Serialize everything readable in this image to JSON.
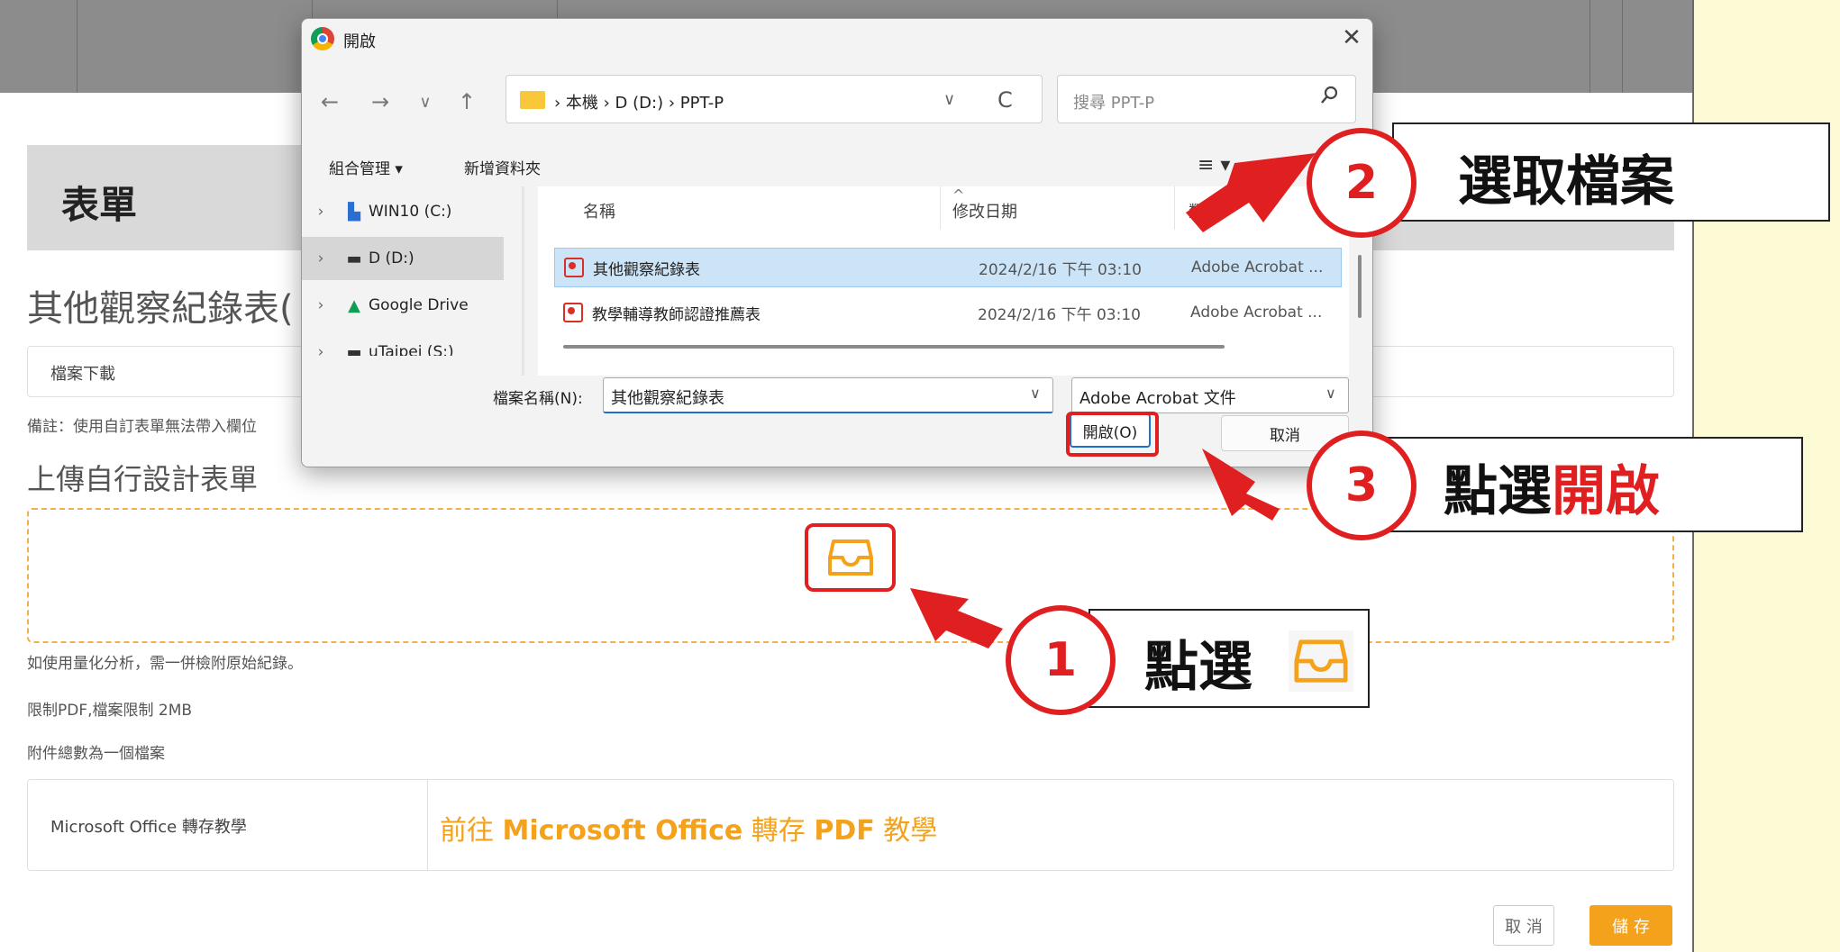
{
  "webpage": {
    "form_title": "表單",
    "section_title": "其他觀察紀錄表(",
    "download_label": "檔案下載",
    "note": "備註：使用自訂表單無法帶入欄位",
    "upload_title": "上傳自行設計表單",
    "hints": [
      "如使用量化分析，需一併檢附原始紀錄。",
      "限制PDF,檔案限制 2MB",
      "附件總數為一個檔案"
    ],
    "ms_label": "Microsoft Office 轉存教學",
    "ms_link_prefix": "前往 ",
    "ms_link_brand": "Microsoft Office",
    "ms_link_mid": " 轉存 ",
    "ms_link_pdf": "PDF",
    "ms_link_suffix": " 教學",
    "cancel_label": "取 消",
    "save_label": "儲 存",
    "accent_color": "#f4a21b"
  },
  "dialog": {
    "title": "開啟",
    "close": "✕",
    "nav": {
      "back": "←",
      "forward": "→",
      "recent": "∨",
      "up": "↑"
    },
    "breadcrumb": "›  本機  ›  D (D:)  ›  PPT-P",
    "addr_dropdown": "∨",
    "refresh": "C",
    "search_placeholder": "搜尋 PPT-P",
    "organize_label": "組合管理 ▾",
    "new_folder_label": "新增資料夾",
    "view_label": "≡ ▾",
    "nav_items": [
      {
        "icon": "drive-c-icon",
        "glyph": "▙",
        "label": "WIN10 (C:)"
      },
      {
        "icon": "drive-d-icon",
        "glyph": "▬",
        "label": "D (D:)"
      },
      {
        "icon": "google-drive-icon",
        "glyph": "▲",
        "label": "Google Drive"
      },
      {
        "icon": "network-drive-icon",
        "glyph": "▬",
        "label": "uTaipei (S:)"
      }
    ],
    "columns": {
      "name": "名稱",
      "modified": "修改日期",
      "type": "類型"
    },
    "files": [
      {
        "name": "其他觀察紀錄表",
        "modified": "2024/2/16 下午 03:10",
        "type": "Adobe Acrobat ...",
        "selected": true
      },
      {
        "name": "教學輔導教師認證推薦表",
        "modified": "2024/2/16 下午 03:10",
        "type": "Adobe Acrobat ...",
        "selected": false
      }
    ],
    "filename_label": "檔案名稱(N):",
    "filename_value": "其他觀察紀錄表",
    "filetype_value": "Adobe Acrobat 文件",
    "open_label": "開啟(O)",
    "cancel_label": "取消"
  },
  "annotations": {
    "step1": {
      "number": "1",
      "text": "點選"
    },
    "step2": {
      "number": "2",
      "text": "選取檔案"
    },
    "step3": {
      "number": "3",
      "text_plain": "點選",
      "text_red": "開啟"
    },
    "highlight_color": "#e02020"
  }
}
